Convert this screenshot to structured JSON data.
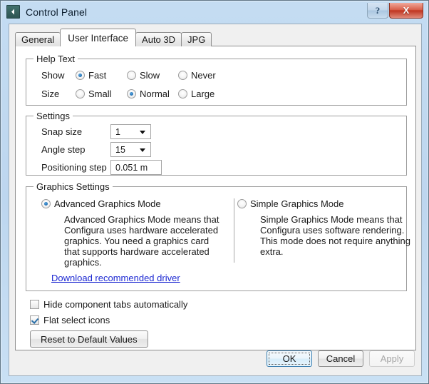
{
  "window": {
    "title": "Control Panel",
    "icon": "back-chevron-icon",
    "caption_buttons": {
      "help": "?",
      "close": "X"
    }
  },
  "tabs": [
    {
      "label": "General",
      "active": false
    },
    {
      "label": "User Interface",
      "active": true
    },
    {
      "label": "Auto 3D",
      "active": false
    },
    {
      "label": "JPG",
      "active": false
    }
  ],
  "help_text": {
    "title": "Help Text",
    "show_label": "Show",
    "show_options": [
      {
        "label": "Fast",
        "checked": true
      },
      {
        "label": "Slow",
        "checked": false
      },
      {
        "label": "Never",
        "checked": false
      }
    ],
    "size_label": "Size",
    "size_options": [
      {
        "label": "Small",
        "checked": false
      },
      {
        "label": "Normal",
        "checked": true
      },
      {
        "label": "Large",
        "checked": false
      }
    ]
  },
  "settings": {
    "title": "Settings",
    "snap_size_label": "Snap size",
    "snap_size_value": "1",
    "angle_step_label": "Angle step",
    "angle_step_value": "15",
    "positioning_step_label": "Positioning step",
    "positioning_step_value": "0.051 m"
  },
  "graphics": {
    "title": "Graphics Settings",
    "advanced_label": "Advanced Graphics Mode",
    "advanced_checked": true,
    "advanced_description": "Advanced Graphics Mode means that Configura uses hardware accelerated graphics. You need a graphics card that supports hardware accelerated graphics.",
    "simple_label": "Simple Graphics Mode",
    "simple_checked": false,
    "simple_description": "Simple Graphics Mode means that Configura uses software rendering. This mode does not require anything extra.",
    "driver_link": "Download recommended driver"
  },
  "options": {
    "hide_component_tabs_label": "Hide component tabs automatically",
    "hide_component_tabs_checked": false,
    "flat_select_icons_label": "Flat select icons",
    "flat_select_icons_checked": true,
    "reset_button": "Reset to Default Values"
  },
  "footer": {
    "ok": "OK",
    "cancel": "Cancel",
    "apply": "Apply",
    "apply_disabled": true
  },
  "colors": {
    "titlebar_blue": "#bdd6ef",
    "close_red": "#bf3420",
    "link_blue": "#1c28d2",
    "radio_dot_blue": "#2675b8",
    "check_blue": "#2a6fa8",
    "default_button_border": "#3c7fb1"
  }
}
